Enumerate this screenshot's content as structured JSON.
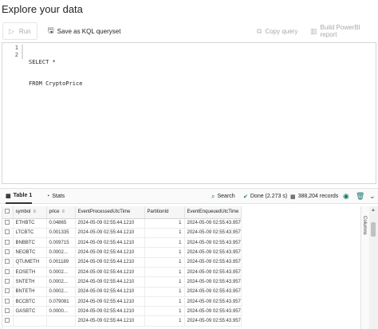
{
  "window": {
    "title": "Explore your data"
  },
  "toolbar": {
    "run_label": "Run",
    "save_label": "Save as KQL queryset",
    "copy_label": "Copy query",
    "powerbi_label": "Build PowerBI report"
  },
  "editor": {
    "line_numbers": [
      "1",
      "2"
    ],
    "lines": [
      "SELECT *",
      "FROM CryptoPrice"
    ]
  },
  "results": {
    "tab1_label": "Table 1",
    "stats_label": "Stats",
    "search_label": "Search",
    "done_label": "Done (2.273 s)",
    "records_label": "388,204 records",
    "columns_panel_label": "Columns",
    "columns": [
      "symbol",
      "price",
      "EventProcessedUtcTime",
      "PartitionId",
      "EventEnqueuedUtcTime"
    ],
    "rows": [
      [
        "ETHBTC",
        "0.04865",
        "2024-05-09 02:55:44.1210",
        "1",
        "2024-05-09 02:55:43.9570"
      ],
      [
        "LTCBTC",
        "0.001335",
        "2024-05-09 02:55:44.1210",
        "1",
        "2024-05-09 02:55:43.9570"
      ],
      [
        "BNBBTC",
        "0.009715",
        "2024-05-09 02:55:44.1210",
        "1",
        "2024-05-09 02:55:43.9570"
      ],
      [
        "NEOBTC",
        "0.0002...",
        "2024-05-09 02:55:44.1210",
        "1",
        "2024-05-09 02:55:43.9570"
      ],
      [
        "QTUMETH",
        "0.001189",
        "2024-05-09 02:55:44.1210",
        "1",
        "2024-05-09 02:55:43.9570"
      ],
      [
        "EOSETH",
        "0.0002...",
        "2024-05-09 02:55:44.1210",
        "1",
        "2024-05-09 02:55:43.9570"
      ],
      [
        "SNTETH",
        "0.0002...",
        "2024-05-09 02:55:44.1210",
        "1",
        "2024-05-09 02:55:43.9570"
      ],
      [
        "BNTETH",
        "0.0002...",
        "2024-05-09 02:55:44.1210",
        "1",
        "2024-05-09 02:55:43.9570"
      ],
      [
        "BCCBTC",
        "0.079081",
        "2024-05-09 02:55:44.1210",
        "1",
        "2024-05-09 02:55:43.9570"
      ],
      [
        "GASBTC",
        "0.0000...",
        "2024-05-09 02:55:44.1210",
        "1",
        "2024-05-09 02:55:43.9570"
      ],
      [
        "",
        "",
        "2024-05-09 02:55:44.1210",
        "1",
        "2024-05-09 02:55:43.9570"
      ]
    ]
  },
  "colors": {
    "accent": "#117865",
    "disabled_text": "#a8a8a8"
  }
}
